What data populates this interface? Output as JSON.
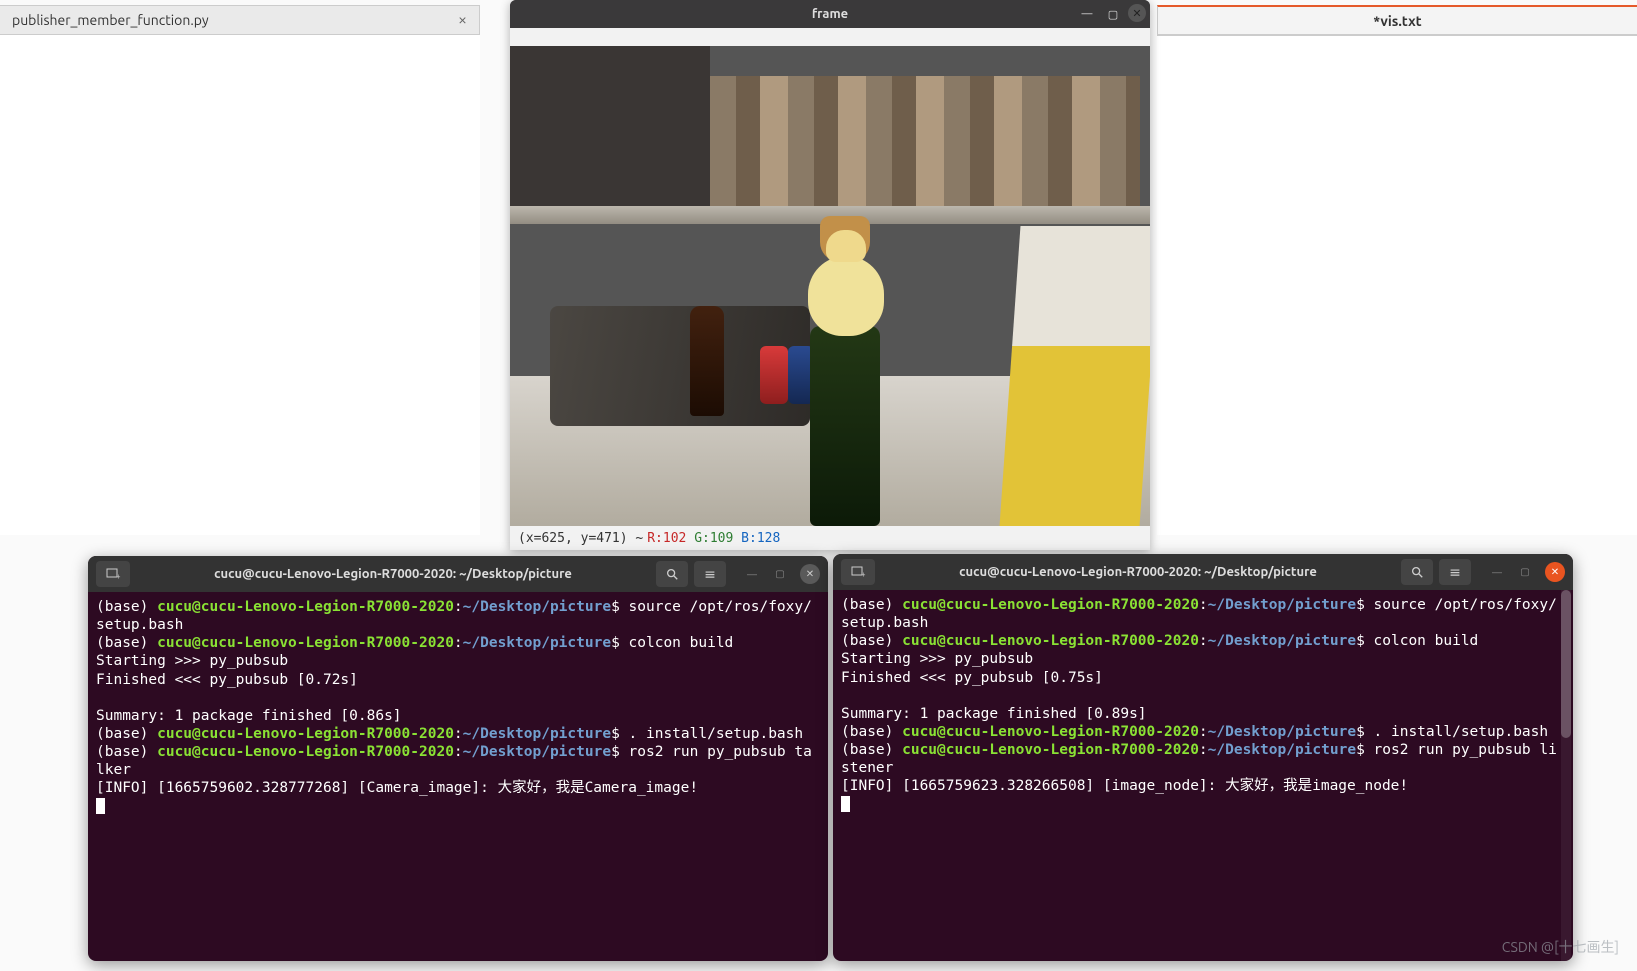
{
  "editor_tabs": {
    "left_title": "publisher_member_function.py",
    "right_title": "*vis.txt"
  },
  "frame_window": {
    "title": "frame",
    "coord_label": "(x=625, y=471) ~ ",
    "r_label": "R:102",
    "g_label": "G:109",
    "b_label": "B:128"
  },
  "term_left": {
    "title": "cucu@cucu-Lenovo-Legion-R7000-2020: ~/Desktop/picture",
    "prompt_env": "(base) ",
    "prompt_user": "cucu@cucu-Lenovo-Legion-R7000-2020",
    "prompt_colon": ":",
    "prompt_path": "~/Desktop/picture",
    "prompt_dollar": "$ ",
    "cmd1": "source /opt/ros/foxy/setup.bash",
    "cmd2": "colcon build",
    "out2a": "Starting >>> py_pubsub",
    "out2b": "Finished <<< py_pubsub [0.72s]",
    "out2c": "Summary: 1 package finished [0.86s]",
    "cmd3": ". install/setup.bash",
    "cmd4": "ros2 run py_pubsub talker",
    "out4": "[INFO] [1665759602.328777268] [Camera_image]: 大家好，我是Camera_image!"
  },
  "term_right": {
    "title": "cucu@cucu-Lenovo-Legion-R7000-2020: ~/Desktop/picture",
    "prompt_env": "(base) ",
    "prompt_user": "cucu@cucu-Lenovo-Legion-R7000-2020",
    "prompt_colon": ":",
    "prompt_path": "~/Desktop/picture",
    "prompt_dollar": "$ ",
    "cmd1": "source /opt/ros/foxy/setup.bash",
    "cmd2": "colcon build",
    "out2a": "Starting >>> py_pubsub",
    "out2b": "Finished <<< py_pubsub [0.75s]",
    "out2c": "Summary: 1 package finished [0.89s]",
    "cmd3": ". install/setup.bash",
    "cmd4": "ros2 run py_pubsub listener",
    "out4": "[INFO] [1665759623.328266508] [image_node]: 大家好，我是image_node!"
  },
  "watermark": "CSDN @[十七画生]"
}
